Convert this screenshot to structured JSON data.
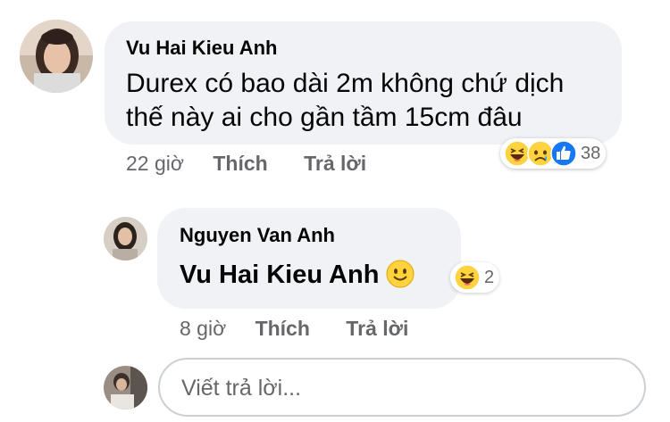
{
  "comment": {
    "author": "Vu Hai Kieu Anh",
    "line1": "Durex có bao dài 2m không chứ dịch",
    "line2": "thế này ai cho gần tầm 15cm đâu",
    "time": "22 giờ",
    "like_label": "Thích",
    "reply_label": "Trả lời",
    "reactions": {
      "icons": [
        "haha-icon",
        "sad-icon",
        "like-icon"
      ],
      "count": "38"
    }
  },
  "reply": {
    "author": "Nguyen Van Anh",
    "mention": "Vu Hai Kieu Anh",
    "emoji": "slight-smile-icon",
    "time": "8 giờ",
    "like_label": "Thích",
    "reply_label": "Trả lời",
    "reactions": {
      "icons": [
        "haha-icon"
      ],
      "count": "2"
    }
  },
  "reply_box": {
    "placeholder": "Viết trả lời..."
  },
  "colors": {
    "bubble": "#f0f2f5",
    "meta": "#65676b",
    "like_blue": "#1877f2",
    "emoji_yellow": "#ffd23f"
  }
}
